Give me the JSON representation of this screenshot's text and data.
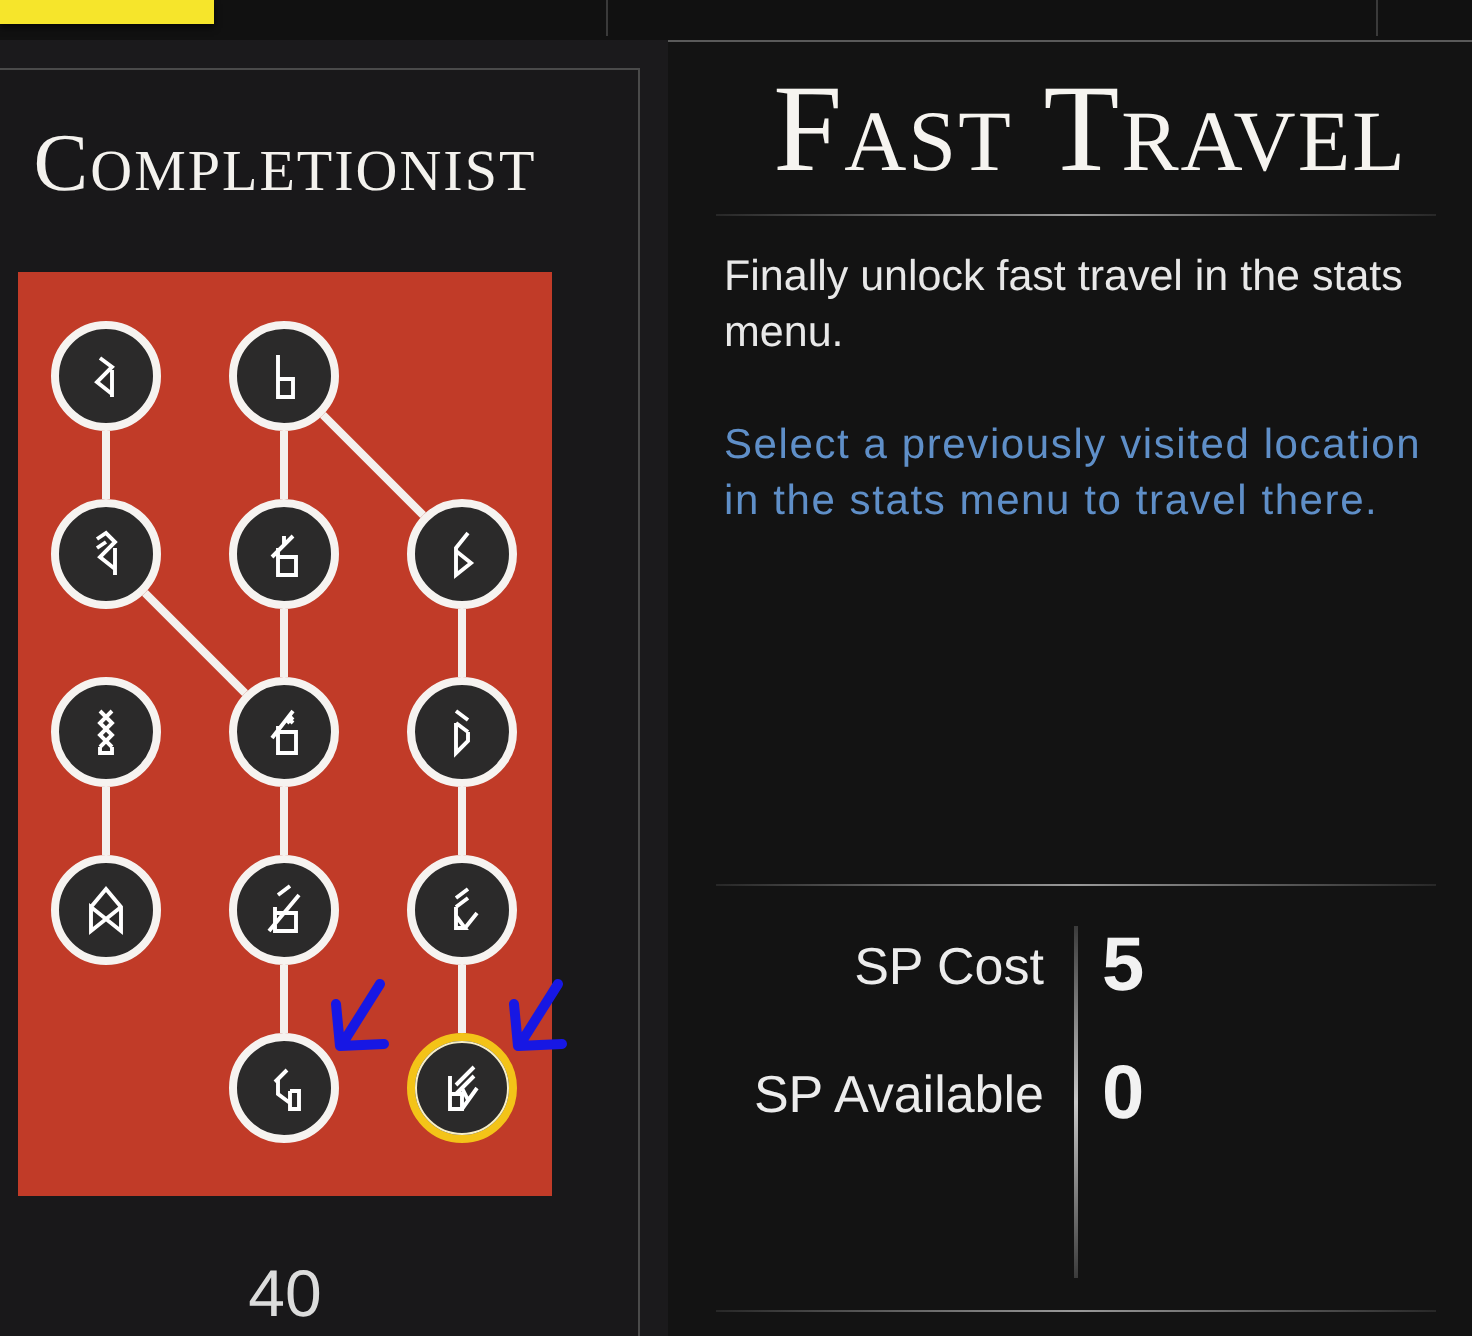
{
  "skill_tree": {
    "title": "Completionist",
    "rows": [
      [
        {
          "kind": "node",
          "selected": false,
          "marked": false,
          "link_down": true,
          "link_down_right": false
        },
        {
          "kind": "node",
          "selected": false,
          "marked": false,
          "link_down": true,
          "link_down_right": true
        },
        {
          "kind": "empty"
        }
      ],
      [
        {
          "kind": "node",
          "selected": false,
          "marked": false,
          "link_down": false,
          "link_down_right": true
        },
        {
          "kind": "node",
          "selected": false,
          "marked": false,
          "link_down": true,
          "link_down_right": false
        },
        {
          "kind": "node",
          "selected": false,
          "marked": false,
          "link_down": true,
          "link_down_right": false
        }
      ],
      [
        {
          "kind": "node",
          "selected": false,
          "marked": false,
          "link_down": true,
          "link_down_right": false
        },
        {
          "kind": "node",
          "selected": false,
          "marked": false,
          "link_down": true,
          "link_down_right": false
        },
        {
          "kind": "node",
          "selected": false,
          "marked": false,
          "link_down": true,
          "link_down_right": false
        }
      ],
      [
        {
          "kind": "node",
          "selected": false,
          "marked": false,
          "link_down": false,
          "link_down_right": false
        },
        {
          "kind": "node",
          "selected": false,
          "marked": false,
          "link_down": true,
          "link_down_right": false
        },
        {
          "kind": "node",
          "selected": false,
          "marked": false,
          "link_down": true,
          "link_down_right": false
        }
      ],
      [
        {
          "kind": "empty"
        },
        {
          "kind": "node",
          "selected": false,
          "marked": true,
          "link_down": false,
          "link_down_right": false
        },
        {
          "kind": "node",
          "selected": true,
          "marked": true,
          "link_down": false,
          "link_down_right": false
        }
      ]
    ],
    "points": "40"
  },
  "skill_details": {
    "title": "Fast Travel",
    "description": "Finally unlock fast travel in the stats menu.",
    "hint": "Select a previously visited location in the stats menu to travel there.",
    "stats": [
      {
        "label": "SP Cost",
        "value": "5"
      },
      {
        "label": "SP Available",
        "value": "0"
      }
    ]
  }
}
